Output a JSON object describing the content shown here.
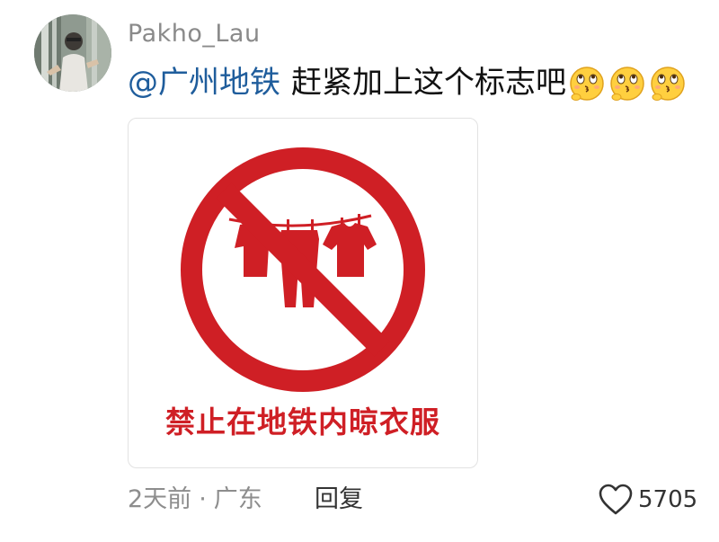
{
  "user": {
    "name": "Pakho_Lau",
    "avatar_icon": "user-avatar-photo"
  },
  "comment": {
    "mention": "@广州地铁",
    "text": "赶紧加上这个标志吧",
    "emoji_icon": "thinking-kiss-emoji",
    "emoji_count": 3
  },
  "sign": {
    "caption": "禁止在地铁内晾衣服",
    "color": "#cf1f25",
    "icon": "no-drying-clothes-sign"
  },
  "footer": {
    "time": "2天前",
    "separator": "·",
    "location": "广东",
    "reply_label": "回复",
    "like_icon": "heart-outline-icon",
    "like_count": "5705"
  }
}
